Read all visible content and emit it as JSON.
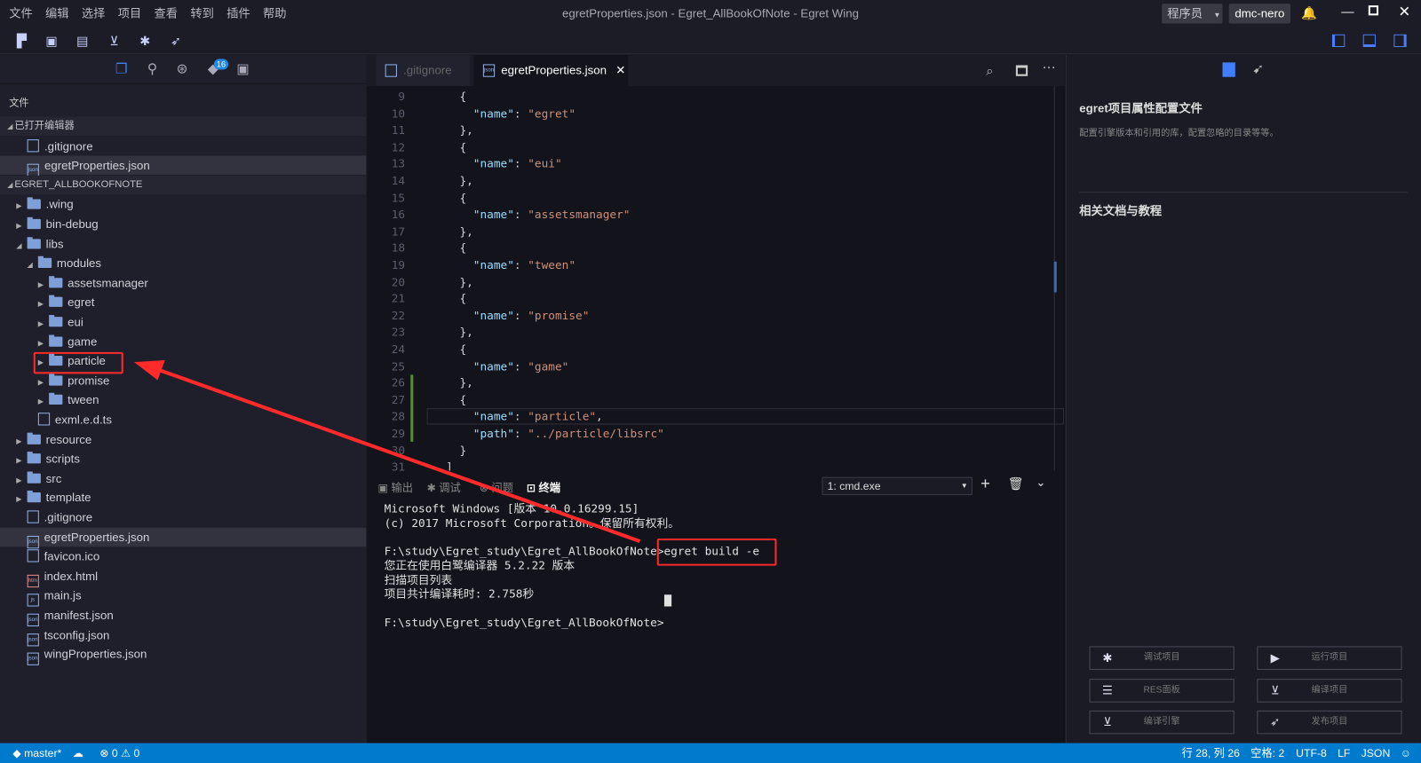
{
  "window": {
    "title": "egretProperties.json - Egret_AllBookOfNote - Egret Wing",
    "role": "程序员",
    "user": "dmc-nero"
  },
  "menu": [
    "文件",
    "编辑",
    "选择",
    "项目",
    "查看",
    "转到",
    "插件",
    "帮助"
  ],
  "toolbar_icons": [
    "new-folder-icon",
    "save-icon",
    "save-all-icon",
    "build-icon",
    "debug-icon",
    "publish-icon"
  ],
  "sidebar": {
    "badge": "16",
    "section_label": "文件",
    "open_editors_label": "已打开编辑器",
    "open_editors": [
      {
        "name": ".gitignore",
        "type": "file"
      },
      {
        "name": "egretProperties.json",
        "type": "json",
        "selected": true
      }
    ],
    "project_label": "EGRET_ALLBOOKOFNOTE",
    "tree": [
      {
        "name": ".wing",
        "depth": 0,
        "type": "folder",
        "expanded": false
      },
      {
        "name": "bin-debug",
        "depth": 0,
        "type": "folder",
        "expanded": false
      },
      {
        "name": "libs",
        "depth": 0,
        "type": "folder",
        "expanded": true
      },
      {
        "name": "modules",
        "depth": 1,
        "type": "folder",
        "expanded": true
      },
      {
        "name": "assetsmanager",
        "depth": 2,
        "type": "folder",
        "expanded": false
      },
      {
        "name": "egret",
        "depth": 2,
        "type": "folder",
        "expanded": false
      },
      {
        "name": "eui",
        "depth": 2,
        "type": "folder",
        "expanded": false
      },
      {
        "name": "game",
        "depth": 2,
        "type": "folder",
        "expanded": false
      },
      {
        "name": "particle",
        "depth": 2,
        "type": "folder",
        "expanded": false,
        "highlighted": true
      },
      {
        "name": "promise",
        "depth": 2,
        "type": "folder",
        "expanded": false
      },
      {
        "name": "tween",
        "depth": 2,
        "type": "folder",
        "expanded": false
      },
      {
        "name": "exml.e.d.ts",
        "depth": 1,
        "type": "file"
      },
      {
        "name": "resource",
        "depth": 0,
        "type": "folder",
        "expanded": false
      },
      {
        "name": "scripts",
        "depth": 0,
        "type": "folder",
        "expanded": false
      },
      {
        "name": "src",
        "depth": 0,
        "type": "folder",
        "expanded": false
      },
      {
        "name": "template",
        "depth": 0,
        "type": "folder",
        "expanded": false
      },
      {
        "name": ".gitignore",
        "depth": 0,
        "type": "file"
      },
      {
        "name": "egretProperties.json",
        "depth": 0,
        "type": "json",
        "selected": true
      },
      {
        "name": "favicon.ico",
        "depth": 0,
        "type": "file"
      },
      {
        "name": "index.html",
        "depth": 0,
        "type": "html"
      },
      {
        "name": "main.js",
        "depth": 0,
        "type": "js"
      },
      {
        "name": "manifest.json",
        "depth": 0,
        "type": "json"
      },
      {
        "name": "tsconfig.json",
        "depth": 0,
        "type": "json"
      },
      {
        "name": "wingProperties.json",
        "depth": 0,
        "type": "json"
      }
    ]
  },
  "editor": {
    "tabs": [
      {
        "label": ".gitignore",
        "active": false
      },
      {
        "label": "egretProperties.json",
        "active": true
      }
    ],
    "lines": [
      {
        "n": "9",
        "i": "    ",
        "t": [
          [
            "p",
            "{"
          ]
        ]
      },
      {
        "n": "10",
        "i": "      ",
        "t": [
          [
            "k",
            "\"name\""
          ],
          [
            "p",
            ": "
          ],
          [
            "s",
            "\"egret\""
          ]
        ]
      },
      {
        "n": "11",
        "i": "    ",
        "t": [
          [
            "p",
            "},"
          ]
        ]
      },
      {
        "n": "12",
        "i": "    ",
        "t": [
          [
            "p",
            "{"
          ]
        ]
      },
      {
        "n": "13",
        "i": "      ",
        "t": [
          [
            "k",
            "\"name\""
          ],
          [
            "p",
            ": "
          ],
          [
            "s",
            "\"eui\""
          ]
        ]
      },
      {
        "n": "14",
        "i": "    ",
        "t": [
          [
            "p",
            "},"
          ]
        ]
      },
      {
        "n": "15",
        "i": "    ",
        "t": [
          [
            "p",
            "{"
          ]
        ]
      },
      {
        "n": "16",
        "i": "      ",
        "t": [
          [
            "k",
            "\"name\""
          ],
          [
            "p",
            ": "
          ],
          [
            "s",
            "\"assetsmanager\""
          ]
        ]
      },
      {
        "n": "17",
        "i": "    ",
        "t": [
          [
            "p",
            "},"
          ]
        ]
      },
      {
        "n": "18",
        "i": "    ",
        "t": [
          [
            "p",
            "{"
          ]
        ]
      },
      {
        "n": "19",
        "i": "      ",
        "t": [
          [
            "k",
            "\"name\""
          ],
          [
            "p",
            ": "
          ],
          [
            "s",
            "\"tween\""
          ]
        ]
      },
      {
        "n": "20",
        "i": "    ",
        "t": [
          [
            "p",
            "},"
          ]
        ]
      },
      {
        "n": "21",
        "i": "    ",
        "t": [
          [
            "p",
            "{"
          ]
        ]
      },
      {
        "n": "22",
        "i": "      ",
        "t": [
          [
            "k",
            "\"name\""
          ],
          [
            "p",
            ": "
          ],
          [
            "s",
            "\"promise\""
          ]
        ]
      },
      {
        "n": "23",
        "i": "    ",
        "t": [
          [
            "p",
            "},"
          ]
        ]
      },
      {
        "n": "24",
        "i": "    ",
        "t": [
          [
            "p",
            "{"
          ]
        ]
      },
      {
        "n": "25",
        "i": "      ",
        "t": [
          [
            "k",
            "\"name\""
          ],
          [
            "p",
            ": "
          ],
          [
            "s",
            "\"game\""
          ]
        ]
      },
      {
        "n": "26",
        "i": "    ",
        "t": [
          [
            "p",
            "},"
          ]
        ]
      },
      {
        "n": "27",
        "i": "    ",
        "t": [
          [
            "p",
            "{"
          ]
        ]
      },
      {
        "n": "28",
        "i": "      ",
        "t": [
          [
            "k",
            "\"name\""
          ],
          [
            "p",
            ": "
          ],
          [
            "s",
            "\"particle\""
          ],
          [
            "p",
            ","
          ]
        ]
      },
      {
        "n": "29",
        "i": "      ",
        "t": [
          [
            "k",
            "\"path\""
          ],
          [
            "p",
            ": "
          ],
          [
            "s",
            "\"../particle/libsrc\""
          ]
        ]
      },
      {
        "n": "30",
        "i": "    ",
        "t": [
          [
            "p",
            "}"
          ]
        ]
      },
      {
        "n": "31",
        "i": "  ",
        "t": [
          [
            "p",
            "]"
          ]
        ]
      }
    ]
  },
  "panel": {
    "tabs": [
      "输出",
      "调试",
      "问题",
      "终端"
    ],
    "active_tab": "终端",
    "terminal_select": "1: cmd.exe",
    "terminal_lines": [
      "Microsoft Windows [版本 10.0.16299.15]",
      "(c) 2017 Microsoft Corporation。保留所有权利。",
      "",
      "F:\\study\\Egret_study\\Egret_AllBookOfNote>egret build -e",
      "您正在使用白鹭编译器 5.2.22 版本",
      "扫描项目列表",
      "项目共计编译耗时: 2.758秒",
      "",
      "F:\\study\\Egret_study\\Egret_AllBookOfNote>"
    ]
  },
  "right_panel": {
    "title": "egret项目属性配置文件",
    "description": "配置引擎版本和引用的库，配置忽略的目录等等。",
    "docs_title": "相关文档与教程",
    "buttons": [
      {
        "label": "调试项目",
        "icon": "bug-icon"
      },
      {
        "label": "运行项目",
        "icon": "play-icon"
      },
      {
        "label": "RES面板",
        "icon": "res-icon"
      },
      {
        "label": "编译项目",
        "icon": "build-icon"
      },
      {
        "label": "编译引擎",
        "icon": "build-engine-icon"
      },
      {
        "label": "发布项目",
        "icon": "rocket-icon"
      }
    ]
  },
  "status": {
    "branch": "master*",
    "errors": "0",
    "warnings": "0",
    "position": "行 28, 列 26",
    "indent": "空格: 2",
    "encoding": "UTF-8",
    "eol": "LF",
    "language": "JSON"
  },
  "colors": {
    "accent": "#007acc",
    "annotation": "#ff2a2a"
  }
}
